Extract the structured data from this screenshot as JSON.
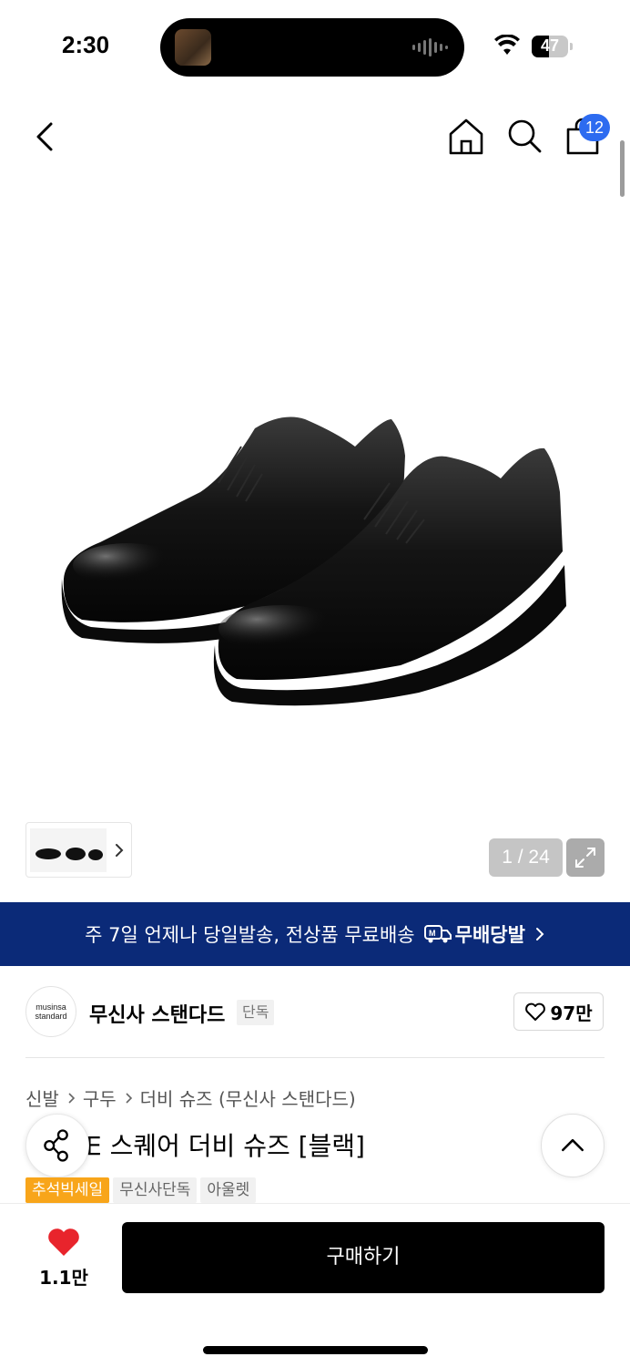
{
  "status_bar": {
    "time": "2:30",
    "battery": "47",
    "battery_level": 0.47
  },
  "header": {
    "cart_count": "12"
  },
  "gallery": {
    "pager": "1 / 24"
  },
  "banner": {
    "text": "주 7일 언제나 당일발송, 전상품 무료배송",
    "logo_text": "무배당발"
  },
  "brand": {
    "logo_line1": "musinsa",
    "logo_line2": "standard",
    "name": "무신사 스탠다드",
    "tag": "단독",
    "likes": "97만"
  },
  "breadcrumb": [
    "신발",
    "구두",
    "더비 슈즈 (무신사 스탠다드)"
  ],
  "product": {
    "title": "E 스퀘어 더비 슈즈 [블랙]"
  },
  "tags": [
    {
      "label": "추석빅세일",
      "color": "#f8a51a"
    },
    {
      "label": "무신사단독"
    },
    {
      "label": "아울렛"
    }
  ],
  "bottom": {
    "like_count": "1.1만",
    "buy_label": "구매하기",
    "heart_color": "#e8242c"
  }
}
